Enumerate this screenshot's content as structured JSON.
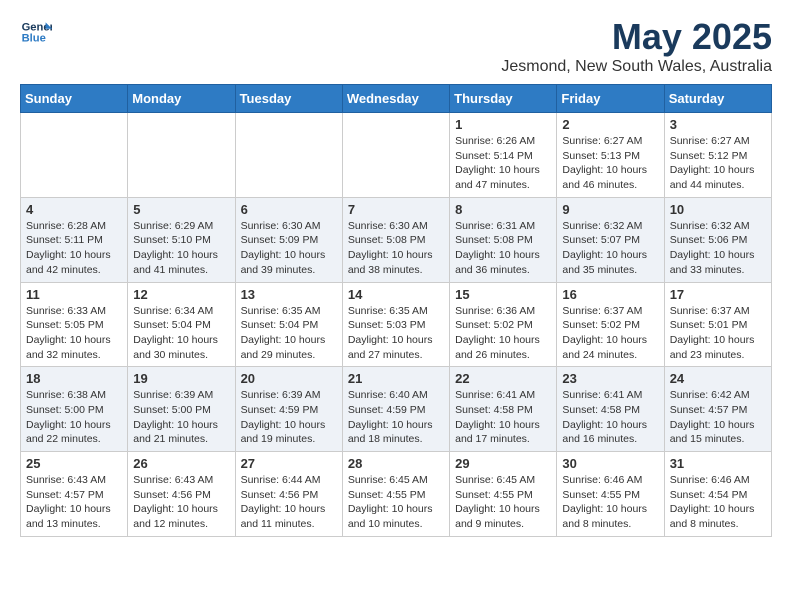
{
  "header": {
    "logo_line1": "General",
    "logo_line2": "Blue",
    "month_title": "May 2025",
    "location": "Jesmond, New South Wales, Australia"
  },
  "days_of_week": [
    "Sunday",
    "Monday",
    "Tuesday",
    "Wednesday",
    "Thursday",
    "Friday",
    "Saturday"
  ],
  "weeks": [
    {
      "days": [
        {
          "num": "",
          "info": ""
        },
        {
          "num": "",
          "info": ""
        },
        {
          "num": "",
          "info": ""
        },
        {
          "num": "",
          "info": ""
        },
        {
          "num": "1",
          "info": "Sunrise: 6:26 AM\nSunset: 5:14 PM\nDaylight: 10 hours\nand 47 minutes."
        },
        {
          "num": "2",
          "info": "Sunrise: 6:27 AM\nSunset: 5:13 PM\nDaylight: 10 hours\nand 46 minutes."
        },
        {
          "num": "3",
          "info": "Sunrise: 6:27 AM\nSunset: 5:12 PM\nDaylight: 10 hours\nand 44 minutes."
        }
      ]
    },
    {
      "days": [
        {
          "num": "4",
          "info": "Sunrise: 6:28 AM\nSunset: 5:11 PM\nDaylight: 10 hours\nand 42 minutes."
        },
        {
          "num": "5",
          "info": "Sunrise: 6:29 AM\nSunset: 5:10 PM\nDaylight: 10 hours\nand 41 minutes."
        },
        {
          "num": "6",
          "info": "Sunrise: 6:30 AM\nSunset: 5:09 PM\nDaylight: 10 hours\nand 39 minutes."
        },
        {
          "num": "7",
          "info": "Sunrise: 6:30 AM\nSunset: 5:08 PM\nDaylight: 10 hours\nand 38 minutes."
        },
        {
          "num": "8",
          "info": "Sunrise: 6:31 AM\nSunset: 5:08 PM\nDaylight: 10 hours\nand 36 minutes."
        },
        {
          "num": "9",
          "info": "Sunrise: 6:32 AM\nSunset: 5:07 PM\nDaylight: 10 hours\nand 35 minutes."
        },
        {
          "num": "10",
          "info": "Sunrise: 6:32 AM\nSunset: 5:06 PM\nDaylight: 10 hours\nand 33 minutes."
        }
      ]
    },
    {
      "days": [
        {
          "num": "11",
          "info": "Sunrise: 6:33 AM\nSunset: 5:05 PM\nDaylight: 10 hours\nand 32 minutes."
        },
        {
          "num": "12",
          "info": "Sunrise: 6:34 AM\nSunset: 5:04 PM\nDaylight: 10 hours\nand 30 minutes."
        },
        {
          "num": "13",
          "info": "Sunrise: 6:35 AM\nSunset: 5:04 PM\nDaylight: 10 hours\nand 29 minutes."
        },
        {
          "num": "14",
          "info": "Sunrise: 6:35 AM\nSunset: 5:03 PM\nDaylight: 10 hours\nand 27 minutes."
        },
        {
          "num": "15",
          "info": "Sunrise: 6:36 AM\nSunset: 5:02 PM\nDaylight: 10 hours\nand 26 minutes."
        },
        {
          "num": "16",
          "info": "Sunrise: 6:37 AM\nSunset: 5:02 PM\nDaylight: 10 hours\nand 24 minutes."
        },
        {
          "num": "17",
          "info": "Sunrise: 6:37 AM\nSunset: 5:01 PM\nDaylight: 10 hours\nand 23 minutes."
        }
      ]
    },
    {
      "days": [
        {
          "num": "18",
          "info": "Sunrise: 6:38 AM\nSunset: 5:00 PM\nDaylight: 10 hours\nand 22 minutes."
        },
        {
          "num": "19",
          "info": "Sunrise: 6:39 AM\nSunset: 5:00 PM\nDaylight: 10 hours\nand 21 minutes."
        },
        {
          "num": "20",
          "info": "Sunrise: 6:39 AM\nSunset: 4:59 PM\nDaylight: 10 hours\nand 19 minutes."
        },
        {
          "num": "21",
          "info": "Sunrise: 6:40 AM\nSunset: 4:59 PM\nDaylight: 10 hours\nand 18 minutes."
        },
        {
          "num": "22",
          "info": "Sunrise: 6:41 AM\nSunset: 4:58 PM\nDaylight: 10 hours\nand 17 minutes."
        },
        {
          "num": "23",
          "info": "Sunrise: 6:41 AM\nSunset: 4:58 PM\nDaylight: 10 hours\nand 16 minutes."
        },
        {
          "num": "24",
          "info": "Sunrise: 6:42 AM\nSunset: 4:57 PM\nDaylight: 10 hours\nand 15 minutes."
        }
      ]
    },
    {
      "days": [
        {
          "num": "25",
          "info": "Sunrise: 6:43 AM\nSunset: 4:57 PM\nDaylight: 10 hours\nand 13 minutes."
        },
        {
          "num": "26",
          "info": "Sunrise: 6:43 AM\nSunset: 4:56 PM\nDaylight: 10 hours\nand 12 minutes."
        },
        {
          "num": "27",
          "info": "Sunrise: 6:44 AM\nSunset: 4:56 PM\nDaylight: 10 hours\nand 11 minutes."
        },
        {
          "num": "28",
          "info": "Sunrise: 6:45 AM\nSunset: 4:55 PM\nDaylight: 10 hours\nand 10 minutes."
        },
        {
          "num": "29",
          "info": "Sunrise: 6:45 AM\nSunset: 4:55 PM\nDaylight: 10 hours\nand 9 minutes."
        },
        {
          "num": "30",
          "info": "Sunrise: 6:46 AM\nSunset: 4:55 PM\nDaylight: 10 hours\nand 8 minutes."
        },
        {
          "num": "31",
          "info": "Sunrise: 6:46 AM\nSunset: 4:54 PM\nDaylight: 10 hours\nand 8 minutes."
        }
      ]
    }
  ]
}
